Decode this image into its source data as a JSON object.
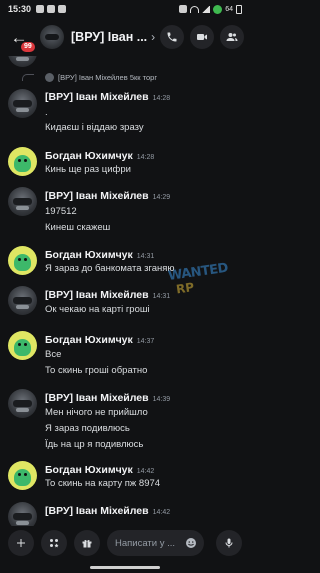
{
  "status_bar": {
    "time": "15:30",
    "battery": "64"
  },
  "header": {
    "unread_badge": "99",
    "channel_title": "[ВРУ] Іван ...",
    "chevron": "›"
  },
  "reply": {
    "author": "[ВРУ] Іван Міхейлев",
    "preview": "5кк торг"
  },
  "messages": [
    {
      "author": "[ВРУ] Іван Міхейлев",
      "time": "14:28",
      "avatar": "ivan",
      "lines": [
        ".",
        "Кидаєш і віддаю зразу"
      ]
    },
    {
      "author": "Богдан Юхимчук",
      "time": "14:28",
      "avatar": "bohdan",
      "lines": [
        "Кинь ще раз цифри"
      ]
    },
    {
      "author": "[ВРУ] Іван Міхейлев",
      "time": "14:29",
      "avatar": "ivan",
      "lines": [
        "197512",
        "Кинеш скажеш"
      ]
    },
    {
      "author": "Богдан Юхимчук",
      "time": "14:31",
      "avatar": "bohdan",
      "lines": [
        "Я зараз до банкомата зганяю"
      ]
    },
    {
      "author": "[ВРУ] Іван Міхейлев",
      "time": "14:31",
      "avatar": "ivan",
      "lines": [
        "Ок чекаю на карті гроші"
      ]
    },
    {
      "author": "Богдан Юхимчук",
      "time": "14:37",
      "avatar": "bohdan",
      "lines": [
        "Все",
        "То скинь гроші обратно"
      ]
    },
    {
      "author": "[ВРУ] Іван Міхейлев",
      "time": "14:39",
      "avatar": "ivan",
      "lines": [
        "Мен нічого не прийшло",
        "Я зараз подивлюсь",
        "Їдь на цр я подивлюсь"
      ]
    },
    {
      "author": "Богдан Юхимчук",
      "time": "14:42",
      "avatar": "bohdan",
      "lines": [
        "То скинь на карту пж 8974"
      ]
    },
    {
      "author": "[ВРУ] Іван Міхейлев",
      "time": "14:42",
      "avatar": "ivan",
      "lines": []
    }
  ],
  "watermark": {
    "top": "WANTED",
    "bottom": "RP"
  },
  "composer": {
    "placeholder": "Написати у ..."
  },
  "icons": {
    "back": "arrow-left-icon",
    "call": "phone-icon",
    "video": "video-camera-icon",
    "members": "people-icon",
    "add": "plus-icon",
    "apps": "apps-icon",
    "gift": "gift-icon",
    "emoji": "smile-icon",
    "voice": "microphone-icon"
  },
  "colors": {
    "background": "#111214",
    "badge": "#da373c",
    "surface": "#232428"
  }
}
